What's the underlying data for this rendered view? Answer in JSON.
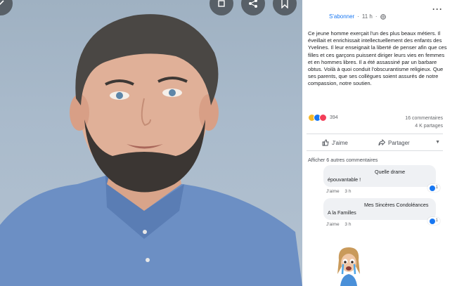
{
  "post": {
    "follow_label": "S'abonner",
    "time": "11 h",
    "text": "Ce jeune homme exerçait l'un des plus beaux métiers. Il éveillait et enrichissait intellectuellement des enfants des Yvelines. Il leur enseignait la liberté de penser afin que ces filles et ces garçons puissent diriger leurs vies en femmes et en hommes libres. Il a été assassiné par un barbare obtus. Voilà à quoi conduit l'obscurantisme religieux. Que ses parents, que ses collègues soient assurés de notre compassion, notre soutien.",
    "reaction_count": "394",
    "comments_count": "16 commentaires",
    "shares_count": "4 K partages",
    "like_label": "J'aime",
    "share_label": "Partager",
    "more_comments_label": "Afficher 6 autres commentaires",
    "colors": {
      "accent": "#1877f2",
      "muted": "#65676b",
      "bubble": "#eff1f4"
    },
    "icons": [
      "share-icon",
      "bookmark-icon",
      "more-icon",
      "globe-icon",
      "like-icon",
      "share-arrow-icon"
    ]
  },
  "comments": [
    {
      "line1": "Quelle drame",
      "line2": "épouvantable !",
      "like_label": "J'aime",
      "time": "3 h",
      "likes": "1"
    },
    {
      "line1": "Mes Sincères Condoléances",
      "line2": "A la Familles",
      "like_label": "J'aime",
      "time": "3 h",
      "likes": "1"
    }
  ]
}
